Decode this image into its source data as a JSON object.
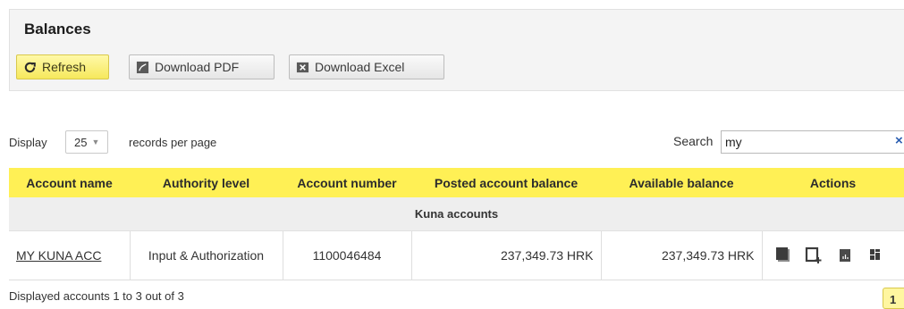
{
  "panel": {
    "title": "Balances",
    "buttons": {
      "refresh": "Refresh",
      "download_pdf": "Download PDF",
      "download_excel": "Download Excel"
    }
  },
  "pager": {
    "display_label": "Display",
    "page_size": "25",
    "per_page_label": "records per page"
  },
  "search": {
    "label": "Search",
    "value": "my",
    "clear_icon": "×"
  },
  "table": {
    "columns": [
      "Account name",
      "Authority level",
      "Account number",
      "Posted account balance",
      "Available balance",
      "Actions"
    ],
    "group_label": "Kuna accounts",
    "rows": [
      {
        "account_name": "MY KUNA ACC",
        "authority_level": "Input & Authorization",
        "account_number": "1100046484",
        "posted_balance": "237,349.73 HRK",
        "available_balance": "237,349.73 HRK",
        "actions": [
          "statement-icon",
          "new-payment-icon",
          "chart-icon",
          "grid-icon"
        ]
      }
    ]
  },
  "footer": {
    "summary": "Displayed accounts 1 to 3 out of 3",
    "current_page": "1"
  },
  "colors": {
    "header_yellow": "#fff055",
    "refresh_yellow": "#f6e85c",
    "group_gray": "#eeeeee",
    "clear_blue": "#2a5db0"
  }
}
